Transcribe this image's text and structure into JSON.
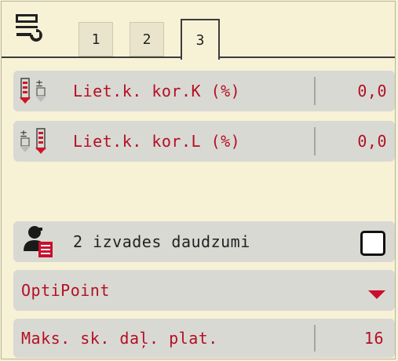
{
  "tabs": [
    {
      "label": "1",
      "active": false
    },
    {
      "label": "2",
      "active": false
    },
    {
      "label": "3",
      "active": true
    }
  ],
  "rows": {
    "corr_k": {
      "label": "Liet.k. kor.K (%)",
      "value": "0,0",
      "icon": "spread-rate-correction-left-icon"
    },
    "corr_l": {
      "label": "Liet.k. kor.L (%)",
      "value": "0,0",
      "icon": "spread-rate-correction-right-icon"
    },
    "dual_output": {
      "label": "2 izvades daudzumi",
      "checked": false,
      "icon": "operator-document-icon"
    },
    "optipoint": {
      "label": "OptiPoint",
      "icon": "dropdown-arrow-icon"
    },
    "max_sections": {
      "label": "Maks. sk. daļ. plat.",
      "value": "16"
    }
  },
  "colors": {
    "background": "#f7f2d6",
    "row": "#d9d9d3",
    "text_accent": "#b40f25",
    "arrow": "#c8102e"
  },
  "icons": {
    "settings": "wrench-settings-icon"
  }
}
